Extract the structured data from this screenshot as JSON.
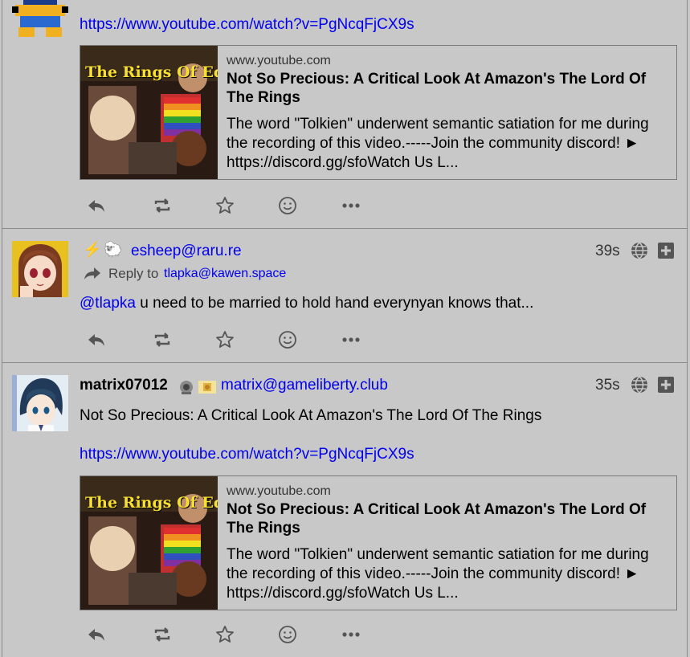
{
  "posts": [
    {
      "link_url": "https://www.youtube.com/watch?v=PgNcqFjCX9s",
      "card": {
        "host": "www.youtube.com",
        "title": "Not So Precious: A Critical Look At Amazon's The Lord Of The Rings",
        "description": "The word \"Tolkien\" underwent semantic satiation for me during the recording of this video.-----Join the community discord! ► https://discord.gg/sfoWatch Us L...",
        "thumb_text": "The Rings Of Equ"
      }
    },
    {
      "emoji": "⚡",
      "sheep": "🐑",
      "handle": "esheep@raru.re",
      "time": "39s",
      "reply_label": "Reply to",
      "reply_to": "tlapka@kawen.space",
      "mention": "@tlapka",
      "text": " u need to be married to hold hand everynyan knows that..."
    },
    {
      "display_name": "matrix07012",
      "handle": "matrix@gameliberty.club",
      "time": "35s",
      "text": "Not So Precious: A Critical Look At Amazon's The Lord Of The Rings",
      "link_url": "https://www.youtube.com/watch?v=PgNcqFjCX9s",
      "card": {
        "host": "www.youtube.com",
        "title": "Not So Precious: A Critical Look At Amazon's The Lord Of The Rings",
        "description": "The word \"Tolkien\" underwent semantic satiation for me during the recording of this video.-----Join the community discord! ► https://discord.gg/sfoWatch Us L...",
        "thumb_text": "The Rings Of Equ"
      }
    }
  ],
  "colors": {
    "background": "#c8c8c8",
    "link": "#0000ee",
    "icon": "#555555",
    "border": "#8a8a8a"
  },
  "icons": [
    "reply-icon",
    "repeat-icon",
    "star-icon",
    "emoji-icon",
    "more-icon",
    "globe-icon",
    "plus-icon"
  ]
}
